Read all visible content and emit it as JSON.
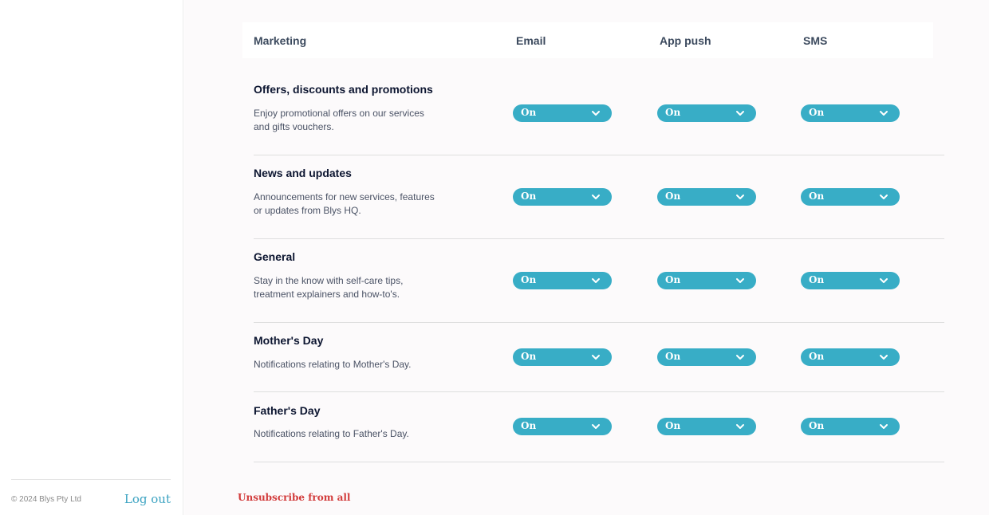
{
  "sidebar": {
    "copyright": "© 2024 Blys Pty Ltd",
    "logout_label": "Log out"
  },
  "header": {
    "marketing": "Marketing",
    "email": "Email",
    "app_push": "App push",
    "sms": "SMS"
  },
  "rows": [
    {
      "title": "Offers, discounts and promotions",
      "desc_line1": "Enjoy promotional offers on our services",
      "desc_line2": "and gifts vouchers.",
      "email": "On",
      "push": "On",
      "sms": "On"
    },
    {
      "title": "News and updates",
      "desc_line1": "Announcements for new services, features",
      "desc_line2": "or updates from Blys HQ.",
      "email": "On",
      "push": "On",
      "sms": "On"
    },
    {
      "title": "General",
      "desc_line1": "Stay in the know with self-care tips,",
      "desc_line2": "treatment explainers and how-to's.",
      "email": "On",
      "push": "On",
      "sms": "On"
    },
    {
      "title": "Mother's Day",
      "desc_line1": "Notifications relating to Mother's Day.",
      "desc_line2": "",
      "email": "On",
      "push": "On",
      "sms": "On"
    },
    {
      "title": "Father's Day",
      "desc_line1": "Notifications relating to Father's Day.",
      "desc_line2": "",
      "email": "On",
      "push": "On",
      "sms": "On"
    }
  ],
  "unsubscribe_label": "Unsubscribe from all",
  "icons": {
    "dropdown": "chevron-down-icon"
  },
  "colors": {
    "accent": "#38adc6",
    "danger": "#d23b3b",
    "heading": "#0c1530",
    "logout": "#3aa2c1"
  }
}
